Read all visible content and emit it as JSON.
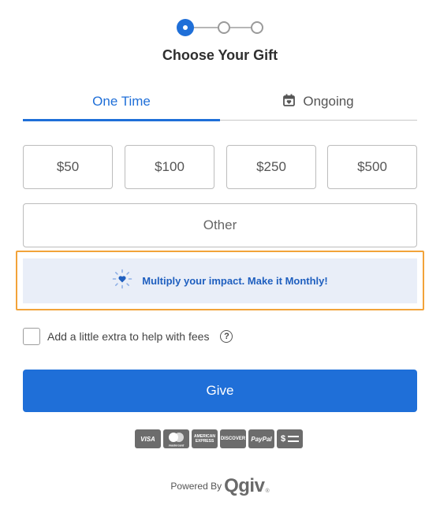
{
  "steps": {
    "count": 3,
    "active_index": 0
  },
  "page_title": "Choose Your Gift",
  "tabs": [
    {
      "label": "One Time",
      "active": true
    },
    {
      "label": "Ongoing",
      "active": false,
      "icon": "calendar-icon"
    }
  ],
  "amounts": [
    "$50",
    "$100",
    "$250",
    "$500"
  ],
  "other_label": "Other",
  "monthly_banner": {
    "text": "Multiply your impact. Make it Monthly!",
    "icon": "sparkle-heart-icon"
  },
  "fees": {
    "label": "Add a little extra to help with fees",
    "checked": false,
    "help_icon": "?"
  },
  "give_label": "Give",
  "payment_methods": [
    {
      "name": "visa",
      "label": "VISA"
    },
    {
      "name": "mastercard",
      "label": "mastercard"
    },
    {
      "name": "amex",
      "label": "AMERICAN EXPRESS"
    },
    {
      "name": "discover",
      "label": "DISCOVER"
    },
    {
      "name": "paypal",
      "label": "PayPal"
    },
    {
      "name": "cash",
      "label": "$"
    }
  ],
  "footer": {
    "powered_by": "Powered By",
    "brand": "Qgiv",
    "registered": "®"
  },
  "colors": {
    "accent": "#1f6fd8",
    "banner_bg": "#e9eef8",
    "highlight_outline": "#f2a33a"
  }
}
